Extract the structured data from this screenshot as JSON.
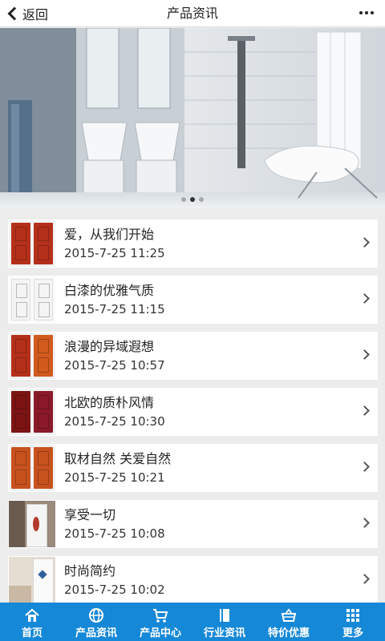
{
  "header": {
    "back_label": "返回",
    "title": "产品资讯"
  },
  "banner": {
    "slide_count": 3,
    "active_index": 1
  },
  "articles": [
    {
      "title": "爱，从我们开始",
      "date": "2015-7-25 11:25",
      "thumb": "red-doors"
    },
    {
      "title": "白漆的优雅气质",
      "date": "2015-7-25 11:15",
      "thumb": "white-doors"
    },
    {
      "title": "浪漫的异域遐想",
      "date": "2015-7-25 10:57",
      "thumb": "orange-doors"
    },
    {
      "title": "北欧的质朴风情",
      "date": "2015-7-25 10:30",
      "thumb": "maroon-doors"
    },
    {
      "title": "取材自然 关爱自然",
      "date": "2015-7-25 10:21",
      "thumb": "copper-doors"
    },
    {
      "title": "享受一切",
      "date": "2015-7-25 10:08",
      "thumb": "room-door"
    },
    {
      "title": "时尚简约",
      "date": "2015-7-25 10:02",
      "thumb": "bedroom-door"
    }
  ],
  "tabbar": {
    "items": [
      {
        "label": "首页",
        "icon": "home-icon"
      },
      {
        "label": "产品资讯",
        "icon": "globe-icon"
      },
      {
        "label": "产品中心",
        "icon": "cart-icon"
      },
      {
        "label": "行业资讯",
        "icon": "book-icon"
      },
      {
        "label": "特价优惠",
        "icon": "basket-icon"
      },
      {
        "label": "更多",
        "icon": "grid-icon"
      }
    ]
  },
  "colors": {
    "tabbar": "#1688d8",
    "background": "#ececec"
  }
}
